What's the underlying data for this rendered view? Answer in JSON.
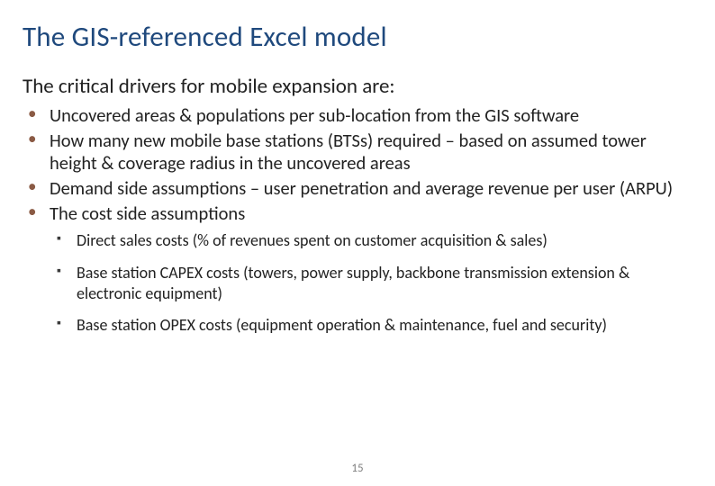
{
  "title": "The GIS-referenced Excel model",
  "subtitle": "The critical drivers for mobile expansion are:",
  "bullets": [
    "Uncovered areas & populations per sub-location from the GIS software",
    "How many new mobile base stations (BTSs) required – based on assumed tower height & coverage radius in the uncovered areas",
    "Demand side assumptions – user penetration and average revenue per user (ARPU)",
    "The cost side assumptions"
  ],
  "subbullets": [
    "Direct sales costs (% of revenues spent on customer acquisition & sales)",
    "Base station CAPEX costs (towers, power supply, backbone transmission extension & electronic equipment)",
    "Base station OPEX costs (equipment operation & maintenance, fuel and security)"
  ],
  "pageNumber": "15"
}
